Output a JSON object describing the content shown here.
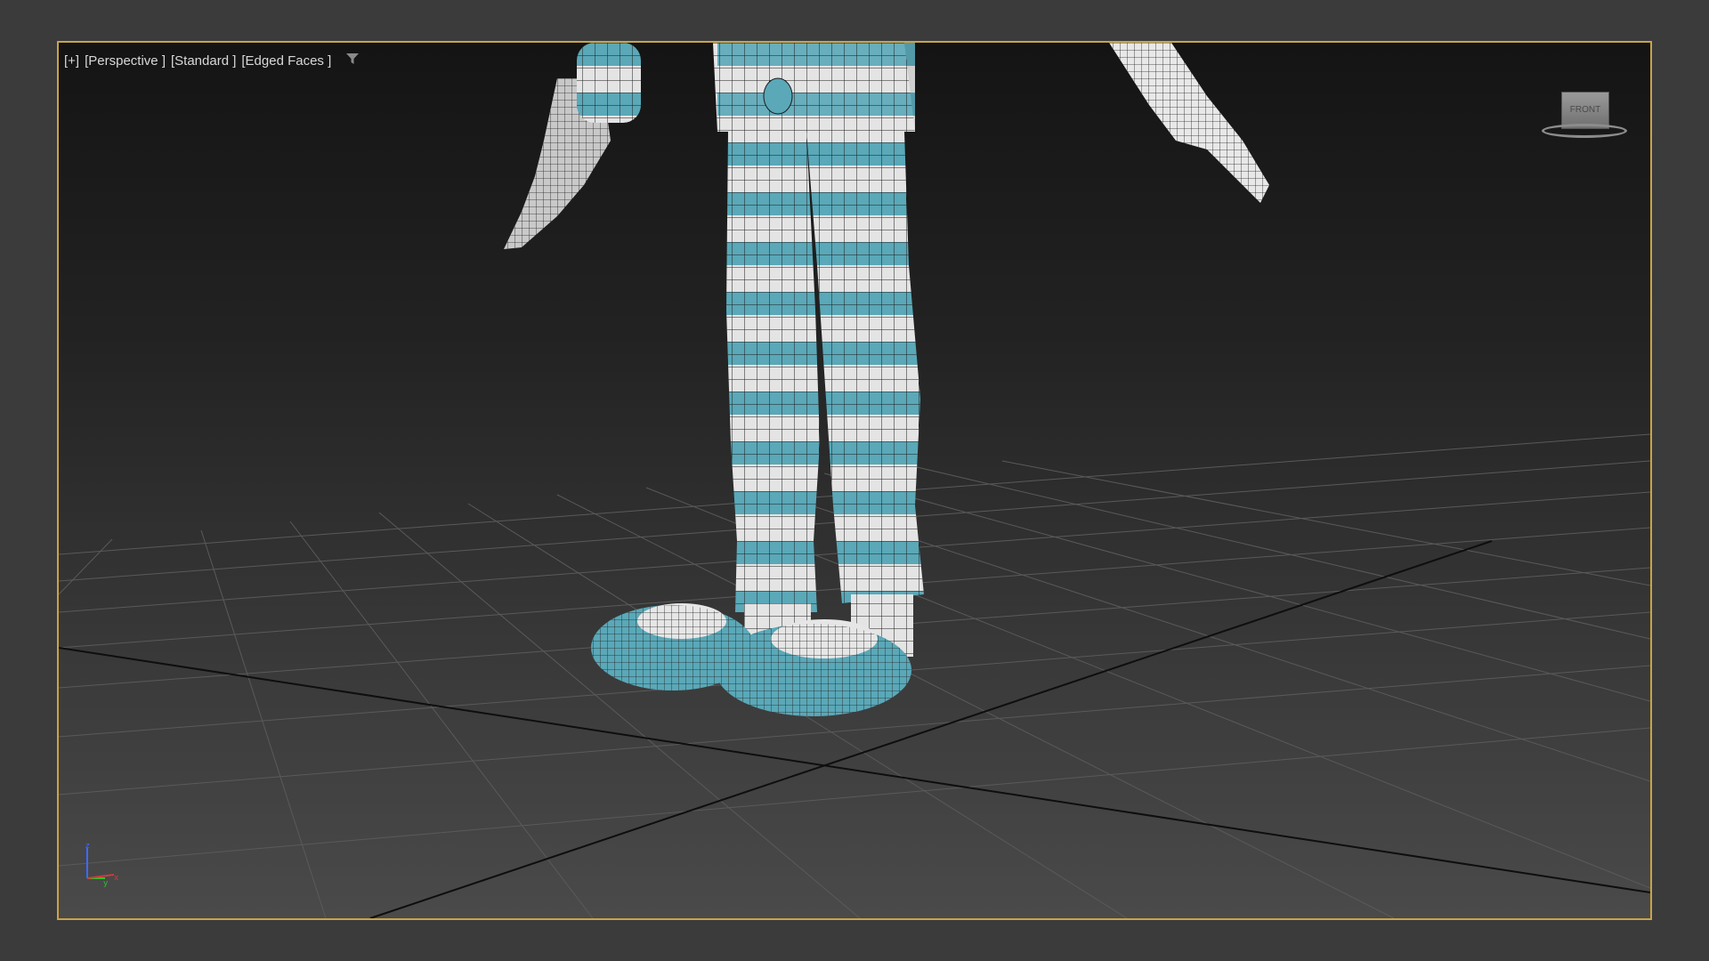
{
  "viewport": {
    "labels": {
      "plus": "[+]",
      "view": "[Perspective ]",
      "shading": "[Standard ]",
      "edges": "[Edged Faces ]"
    },
    "filter_icon": "funnel-icon",
    "viewcube_face": "FRONT",
    "border_color": "#c8a448"
  },
  "scene": {
    "pattern_colors": {
      "teal": "#5aa8b8",
      "white": "#e6e6e6",
      "wire": "#1c1c1c"
    }
  },
  "axis": {
    "x": "x",
    "y": "y",
    "z": "z"
  }
}
